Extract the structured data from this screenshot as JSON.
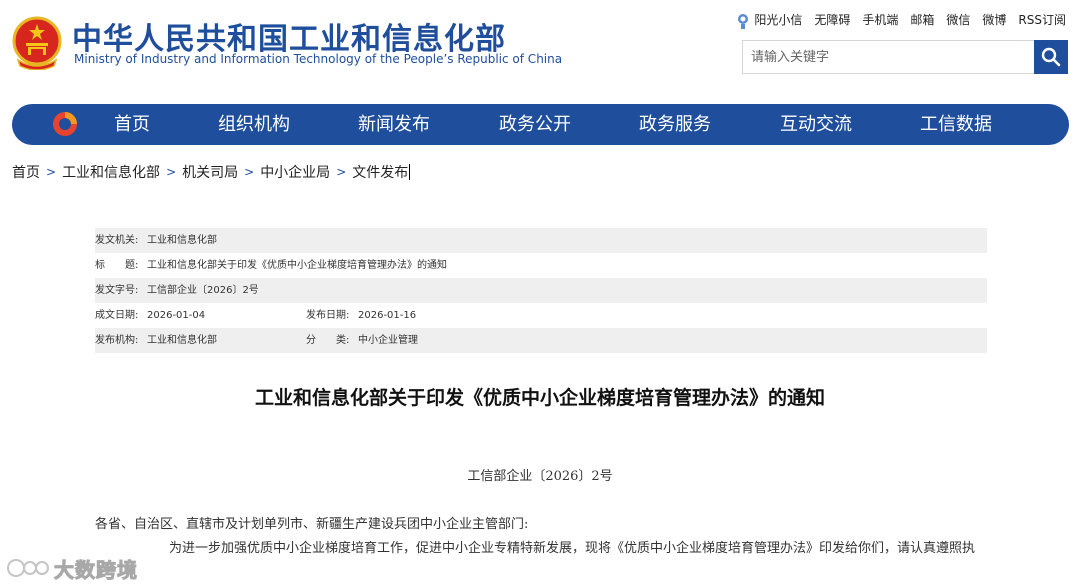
{
  "header": {
    "org_name_cn": "中华人民共和国工业和信息化部",
    "org_name_en": "Ministry of Industry and Information Technology of the People’s Republic of China",
    "top_links": [
      "阳光小信",
      "无障碍",
      "手机端",
      "邮箱",
      "微信",
      "微博",
      "RSS订阅"
    ],
    "search_placeholder": "请输入关键字"
  },
  "nav": {
    "items": [
      "首页",
      "组织机构",
      "新闻发布",
      "政务公开",
      "政务服务",
      "互动交流",
      "工信数据"
    ]
  },
  "breadcrumb": [
    "首页",
    "工业和信息化部",
    "机关司局",
    "中小企业局",
    "文件发布"
  ],
  "info": {
    "issuer_label": "发文机关:",
    "issuer": "工业和信息化部",
    "title_label": "标　　题:",
    "title": "工业和信息化部关于印发《优质中小企业梯度培育管理办法》的通知",
    "doc_no_label": "发文字号:",
    "doc_no": "工信部企业〔2026〕2号",
    "created_label": "成文日期:",
    "created": "2026-01-04",
    "published_label": "发布日期:",
    "published": "2026-01-16",
    "publisher_label": "发布机构:",
    "publisher": "工业和信息化部",
    "category_label": "分　　类:",
    "category": "中小企业管理"
  },
  "article": {
    "title": "工业和信息化部关于印发《优质中小企业梯度培育管理办法》的通知",
    "number": "工信部企业〔2026〕2号",
    "addressee": "各省、自治区、直辖市及计划单列市、新疆生产建设兵团中小企业主管部门:",
    "paragraph1": "为进一步加强优质中小企业梯度培育工作，促进中小企业专精特新发展，现将《优质中小企业梯度培育管理办法》印发给你们，请认真遵照执"
  },
  "watermark": "大数跨境",
  "colors": {
    "brand_blue": "#1f4e9c",
    "row_shade": "#efefef"
  }
}
